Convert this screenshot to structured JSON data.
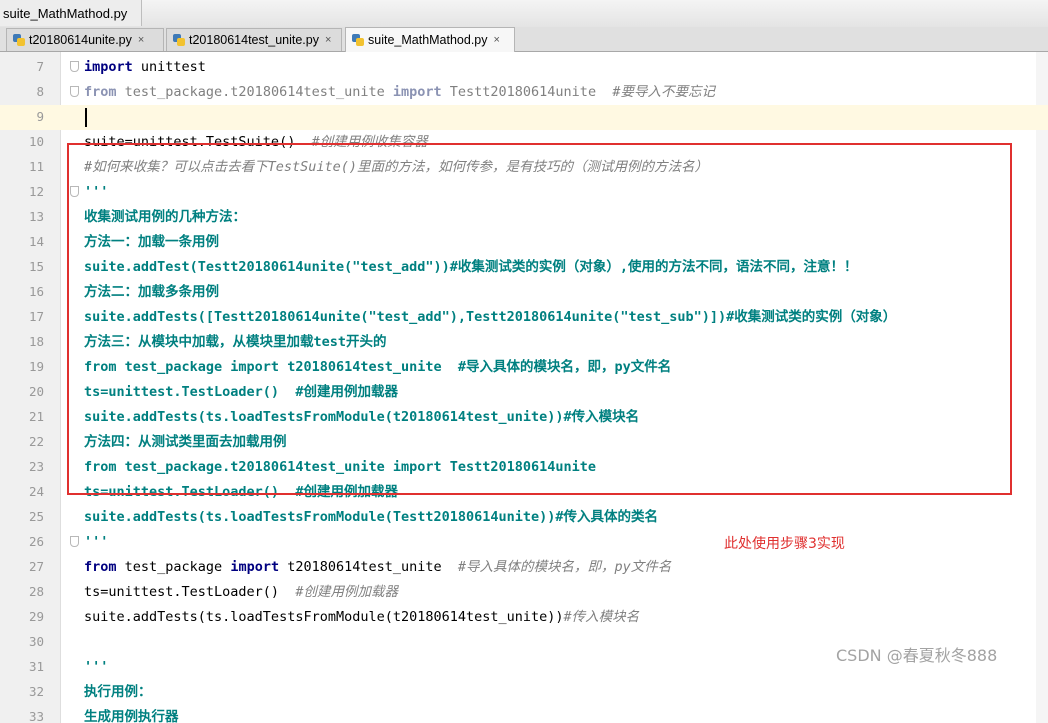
{
  "breadcrumb": {
    "file": "suite_MathMathod.py"
  },
  "tabs": [
    {
      "label": "t20180614unite.py",
      "close": "×",
      "active": false
    },
    {
      "label": "t20180614test_unite.py",
      "close": "×",
      "active": false
    },
    {
      "label": "suite_MathMathod.py",
      "close": "×",
      "active": true
    }
  ],
  "icons": {
    "python_file": "python-file-icon",
    "close": "close-icon",
    "fold": "fold-marker-icon"
  },
  "colors": {
    "keyword": "#000080",
    "comment": "#808080",
    "docstring": "#008080",
    "annotation": "#e0302f",
    "current_line": "#fff9e2"
  },
  "editor": {
    "current_line": "9",
    "lines": [
      {
        "num": "7",
        "kw": "import",
        "text": " unittest",
        "comment": ""
      },
      {
        "num": "8",
        "kw": "from",
        "text": " test_package.t20180614test_unite ",
        "kw2": "import",
        "text2": " Testt20180614unite  ",
        "comment": "#要导入不要忘记"
      },
      {
        "num": "9",
        "text": ""
      },
      {
        "num": "10",
        "text": "suite=unittest.TestSuite()  ",
        "comment": "#创建用例收集容器"
      },
      {
        "num": "11",
        "text": "",
        "comment": "#如何来收集？可以点击去看下TestSuite()里面的方法，如何传参，是有技巧的（测试用例的方法名）"
      },
      {
        "num": "12",
        "doc": "'''"
      },
      {
        "num": "13",
        "doc": "收集测试用例的几种方法："
      },
      {
        "num": "14",
        "doc": "方法一：加载一条用例"
      },
      {
        "num": "15",
        "doc": "suite.addTest(Testt20180614unite(\"test_add\"))#收集测试类的实例（对象）,使用的方法不同，语法不同，注意！！"
      },
      {
        "num": "16",
        "doc": "方法二：加载多条用例"
      },
      {
        "num": "17",
        "doc": "suite.addTests([Testt20180614unite(\"test_add\"),Testt20180614unite(\"test_sub\")])#收集测试类的实例（对象）"
      },
      {
        "num": "18",
        "doc": "方法三：从模块中加载，从模块里加载test开头的"
      },
      {
        "num": "19",
        "doc": "from test_package import t20180614test_unite  #导入具体的模块名，即，py文件名"
      },
      {
        "num": "20",
        "doc": "ts=unittest.TestLoader()  #创建用例加载器"
      },
      {
        "num": "21",
        "doc": "suite.addTests(ts.loadTestsFromModule(t20180614test_unite))#传入模块名"
      },
      {
        "num": "22",
        "doc": "方法四：从测试类里面去加载用例"
      },
      {
        "num": "23",
        "doc": "from test_package.t20180614test_unite import Testt20180614unite"
      },
      {
        "num": "24",
        "doc": "ts=unittest.TestLoader()  #创建用例加载器"
      },
      {
        "num": "25",
        "doc": "suite.addTests(ts.loadTestsFromModule(Testt20180614unite))#传入具体的类名"
      },
      {
        "num": "26",
        "doc": "'''"
      },
      {
        "num": "27",
        "kw": "from",
        "text": " test_package ",
        "kw2": "import",
        "text2": " t20180614test_unite  ",
        "comment": "#导入具体的模块名，即，py文件名"
      },
      {
        "num": "28",
        "text": "ts=unittest.TestLoader()  ",
        "comment": "#创建用例加载器"
      },
      {
        "num": "29",
        "text": "suite.addTests(ts.loadTestsFromModule(t20180614test_unite))",
        "comment": "#传入模块名"
      },
      {
        "num": "30",
        "text": ""
      },
      {
        "num": "31",
        "doc": "'''"
      },
      {
        "num": "32",
        "doc": "执行用例："
      },
      {
        "num": "33",
        "doc": "生成用例执行器"
      }
    ]
  },
  "annotation": {
    "note": "此处使用步骤3实现"
  },
  "watermark": "CSDN @春夏秋冬888"
}
